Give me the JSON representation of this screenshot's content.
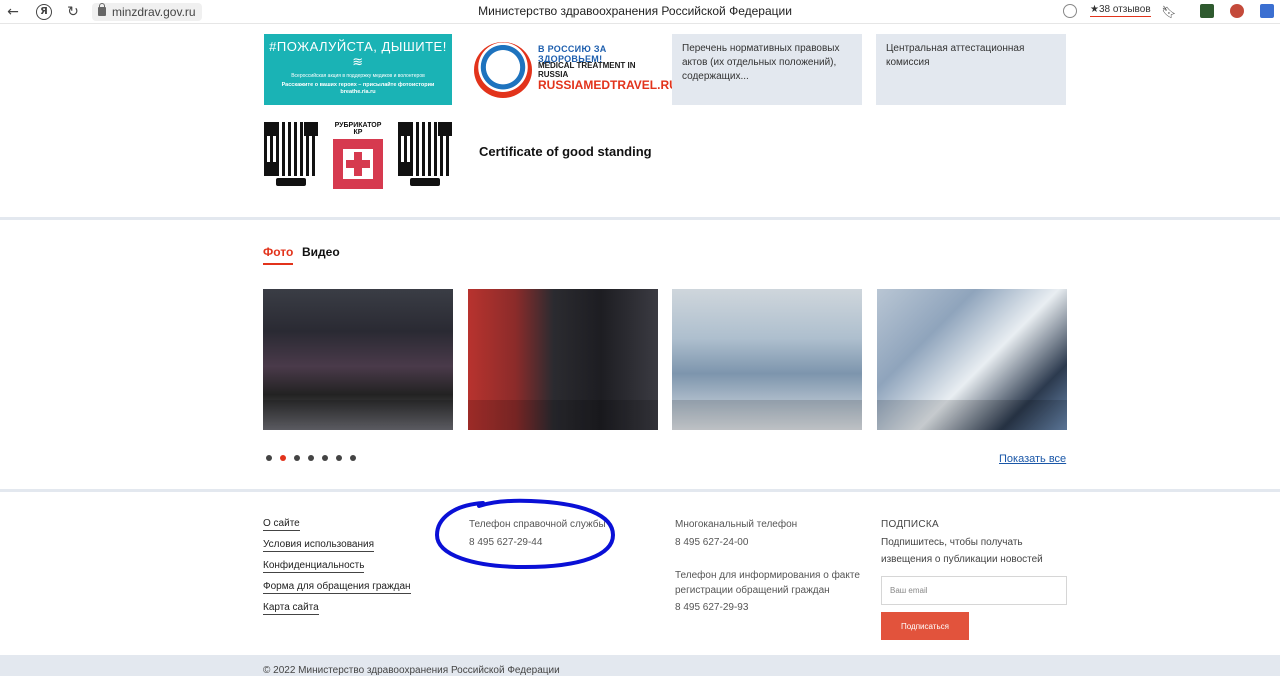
{
  "browser": {
    "url": "minzdrav.gov.ru",
    "page_title": "Министерство здравоохранения Российской Федерации",
    "reviews": "★38 отзывов"
  },
  "banners": {
    "breathe": {
      "title": "#ПОЖАЛУЙСТА, ДЫШИТЕ!≋",
      "subtitle": "Всероссийская акция в поддержку медиков и волонтеров",
      "cta": "Расскажите о ваших героях – присылайте фотоистории breathe.ria.ru"
    },
    "medtravel": {
      "line1": "В РОССИЮ ЗА ЗДОРОВЬЕМ!",
      "line2": "MEDICAL TREATMENT IN RUSSIA",
      "line3": "RUSSIAMEDTRAVEL.RU"
    },
    "normative_acts": "Перечень нормативных правовых актов (их отдельных положений), содержащих...",
    "attestation": "Центральная аттестационная комиссия",
    "rubrikator_label": "РУБРИКАТОР КР",
    "certificate": "Certificate of good standing"
  },
  "media": {
    "tabs": [
      {
        "label": "Фото",
        "active": true
      },
      {
        "label": "Видео",
        "active": false
      }
    ],
    "dots_count": 7,
    "active_dot": 2,
    "show_all": "Показать все"
  },
  "footer": {
    "links": [
      "О сайте",
      "Условия использования",
      "Конфиденциальность",
      "Форма для обращения граждан",
      "Карта сайта"
    ],
    "helpdesk_label": "Телефон справочной службы",
    "helpdesk_phone": "8 495 627-29-44",
    "multichannel_label": "Многоканальный телефон",
    "multichannel_phone": "8 495 627-24-00",
    "registration_label": "Телефон для информирования о факте регистрации обращений граждан",
    "registration_phone": "8 495 627-29-93",
    "subscribe_title": "ПОДПИСКА",
    "subscribe_text": "Подпишитесь, чтобы получать извещения о публикации новостей",
    "email_placeholder": "Ваш email",
    "subscribe_button": "Подписаться",
    "copyright": "© 2022 Министерство здравоохранения Российской Федерации"
  },
  "colors": {
    "accent": "#e2331b",
    "highlight_ellipse": "#0a10d6",
    "banner_teal": "#1ab3b5",
    "banner_gray": "#e3e8ef"
  }
}
